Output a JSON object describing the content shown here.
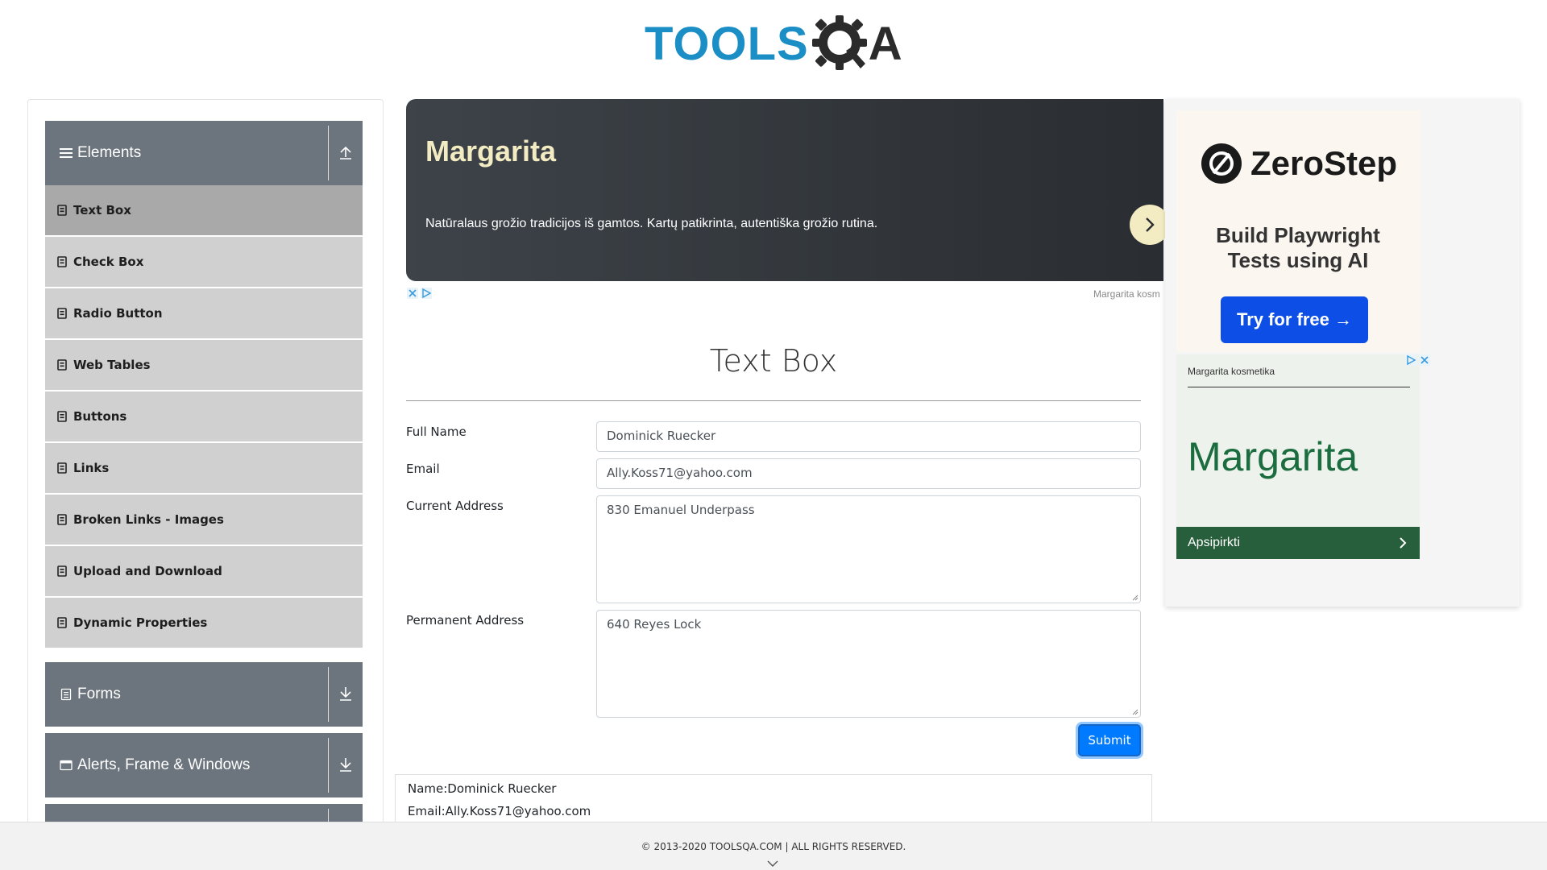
{
  "header": {
    "logo_text": "TOOLS",
    "logo_a": "A"
  },
  "sidebar": {
    "groups": [
      {
        "label": "Elements",
        "expanded": true
      },
      {
        "label": "Forms",
        "expanded": false
      },
      {
        "label": "Alerts, Frame & Windows",
        "expanded": false
      }
    ],
    "items": [
      {
        "label": "Text Box",
        "active": true
      },
      {
        "label": "Check Box"
      },
      {
        "label": "Radio Button"
      },
      {
        "label": "Web Tables"
      },
      {
        "label": "Buttons"
      },
      {
        "label": "Links"
      },
      {
        "label": "Broken Links - Images"
      },
      {
        "label": "Upload and Download"
      },
      {
        "label": "Dynamic Properties"
      }
    ]
  },
  "ad_banner": {
    "title": "Margarita",
    "description": "Natūralaus grožio tradicijos iš gamtos. Kartų patikrinta, autentiška grožio rutina.",
    "source": "Margarita kosm"
  },
  "form": {
    "title": "Text Box",
    "full_name_label": "Full Name",
    "full_name_value": "Dominick Ruecker",
    "email_label": "Email",
    "email_value": "Ally.Koss71@yahoo.com",
    "current_address_label": "Current Address",
    "current_address_value": "830 Emanuel Underpass",
    "permanent_address_label": "Permanent Address",
    "permanent_address_value": "640 Reyes Lock",
    "submit_label": "Submit"
  },
  "output": {
    "name_line": "Name:Dominick Ruecker",
    "email_line": "Email:Ally.Koss71@yahoo.com"
  },
  "side_ad": {
    "zerostep_brand": "ZeroStep",
    "zerostep_headline_1": "Build Playwright",
    "zerostep_headline_2": "Tests using AI",
    "zerostep_cta": "Try for free →",
    "margarita_brand": "Margarita kosmetika",
    "margarita_name": "Margarita",
    "margarita_cta": "Apsipirkti"
  },
  "footer": {
    "copyright": "© 2013-2020 TOOLSQA.COM | ALL RIGHTS RESERVED."
  },
  "colors": {
    "brand_blue": "#1b8fc5",
    "sidebar_header": "#6c757d",
    "menu_item": "#d0d0d0",
    "menu_item_active": "#a9a9a9",
    "submit": "#007bff"
  }
}
